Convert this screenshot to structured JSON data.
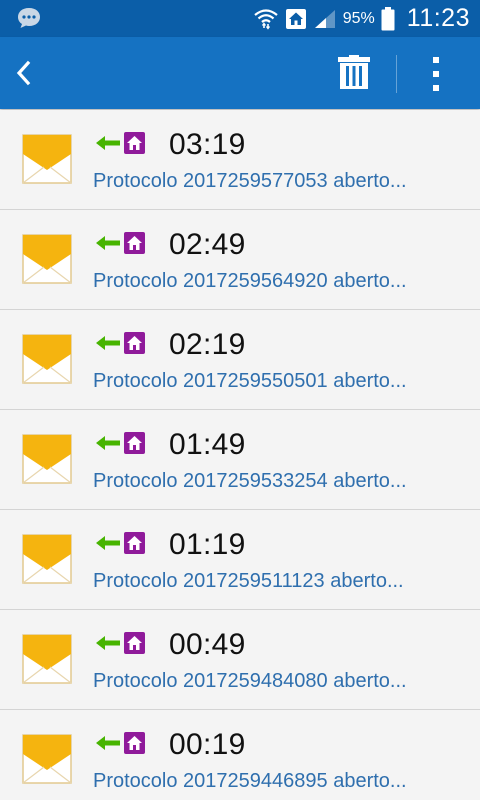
{
  "status_bar": {
    "battery_percent": "95%",
    "time": "11:23",
    "icons": [
      "chat-bubble-icon",
      "wifi-icon",
      "home-network-icon",
      "signal-icon",
      "battery-icon"
    ]
  },
  "action_bar": {
    "icons": [
      "back-arrow-icon",
      "trash-icon",
      "overflow-menu-icon"
    ]
  },
  "colors": {
    "status_bar": "#0b5ea8",
    "action_bar": "#1572c2",
    "envelope": "#f5b40f",
    "arrow": "#47b400",
    "home_badge": "#8f1a9a",
    "subject_text": "#2f6fae"
  },
  "messages": [
    {
      "time": "03:19",
      "subject": "Protocolo 2017259577053 aberto..."
    },
    {
      "time": "02:49",
      "subject": "Protocolo 2017259564920 aberto..."
    },
    {
      "time": "02:19",
      "subject": "Protocolo 2017259550501 aberto..."
    },
    {
      "time": "01:49",
      "subject": "Protocolo 2017259533254 aberto..."
    },
    {
      "time": "01:19",
      "subject": "Protocolo 2017259511123 aberto..."
    },
    {
      "time": "00:49",
      "subject": "Protocolo 2017259484080 aberto..."
    },
    {
      "time": "00:19",
      "subject": "Protocolo 2017259446895 aberto..."
    }
  ]
}
